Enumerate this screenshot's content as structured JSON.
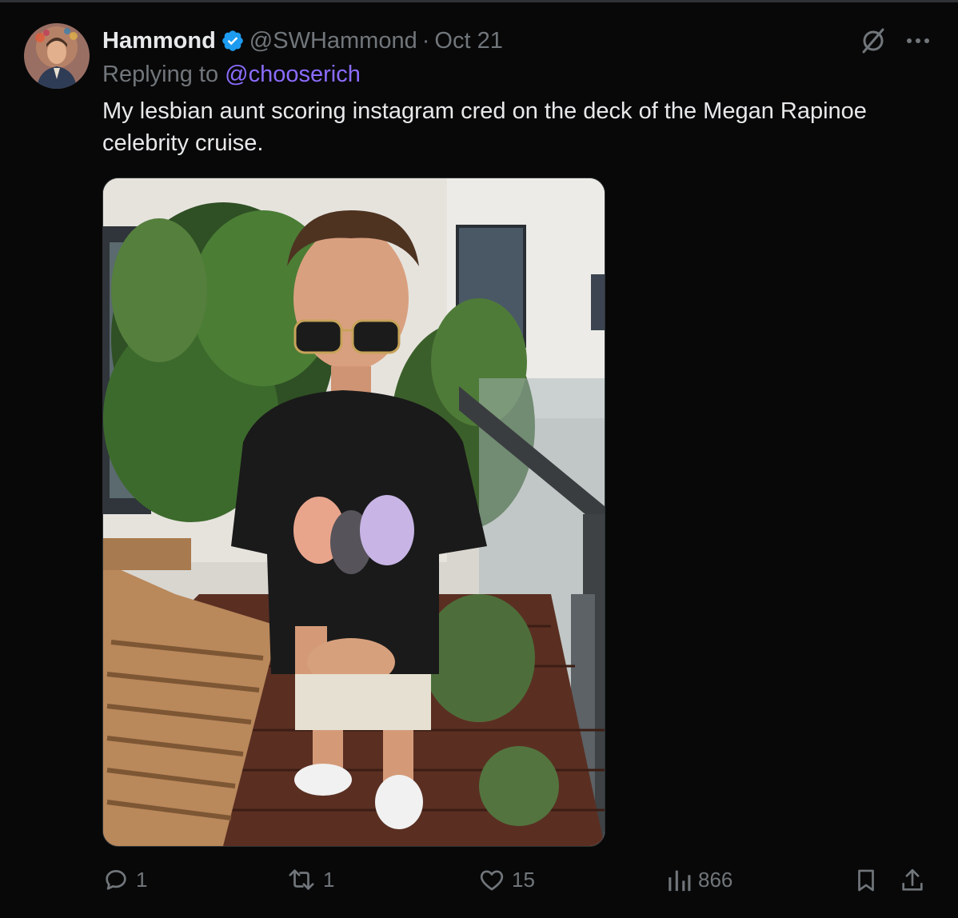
{
  "author": {
    "name": "Hammond",
    "handle": "@SWHammond",
    "separator": "·",
    "date": "Oct 21",
    "verified": true,
    "accent_color": "#1d9bf0"
  },
  "reply": {
    "prefix": "Replying to",
    "mention": "@chooserich",
    "mention_color": "#8b6cff"
  },
  "tweet": {
    "text": "My lesbian aunt scoring instagram cred on the deck of the Megan Rapinoe celebrity cruise."
  },
  "icons": {
    "grok": "grok-slash-icon",
    "more": "more-icon",
    "reply": "reply-icon",
    "repost": "repost-icon",
    "like": "heart-icon",
    "views": "views-icon",
    "bookmark": "bookmark-icon",
    "share": "share-icon"
  },
  "actions": {
    "replies": "1",
    "reposts": "1",
    "likes": "15",
    "views": "866"
  }
}
